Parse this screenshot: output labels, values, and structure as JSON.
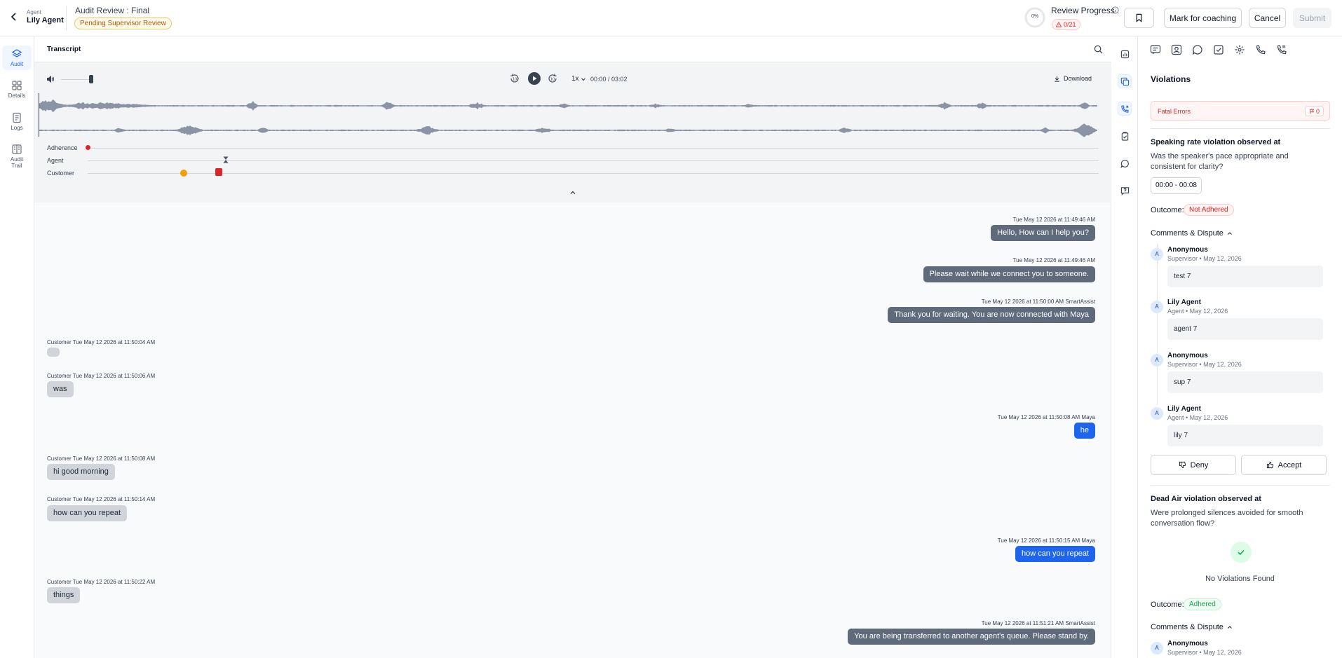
{
  "header": {
    "agent_caption": "Agent",
    "agent_name": "Lily Agent",
    "page_title": "Audit Review : Final",
    "status": "Pending Supervisor Review",
    "progress_percent": "0%",
    "progress_value": 0,
    "review_progress_label": "Review Progress",
    "violation_count": "0/21",
    "mark_coaching": "Mark for coaching",
    "cancel": "Cancel",
    "submit": "Submit"
  },
  "nav": [
    {
      "label": "Audit",
      "icon": "layers-icon",
      "active": true
    },
    {
      "label": "Details",
      "icon": "grid-icon",
      "active": false
    },
    {
      "label": "Logs",
      "icon": "document-icon",
      "active": false
    },
    {
      "label": "Audit Trail",
      "icon": "book-icon",
      "active": false
    }
  ],
  "transcript": {
    "title": "Transcript",
    "speed": "1x",
    "time": "00:00 / 03:02",
    "download": "Download",
    "tracks": [
      "Adherence",
      "Agent",
      "Customer"
    ]
  },
  "messages": [
    {
      "side": "right",
      "meta": "Tue May 12 2026 at 11:49:46 AM",
      "text": "Hello, How can I help you?",
      "style": "dark"
    },
    {
      "side": "right",
      "meta": "Tue May 12 2026 at 11:49:46 AM",
      "text": "Please wait while we connect you to someone.",
      "style": "dark"
    },
    {
      "side": "right",
      "meta": "Tue May 12 2026 at 11:50:00 AM SmartAssist",
      "text": "Thank you for waiting. You are now connected with Maya",
      "style": "dark"
    },
    {
      "side": "left",
      "meta": "Customer  Tue May 12 2026 at 11:50:04 AM",
      "text": "",
      "style": "light"
    },
    {
      "side": "left",
      "meta": "Customer  Tue May 12 2026 at 11:50:06 AM",
      "text": "was",
      "style": "light"
    },
    {
      "side": "right",
      "meta": "Tue May 12 2026 at 11:50:08 AM Maya",
      "text": "he",
      "style": "blue"
    },
    {
      "side": "left",
      "meta": "Customer  Tue May 12 2026 at 11:50:08 AM",
      "text": "hi good morning",
      "style": "light"
    },
    {
      "side": "left",
      "meta": "Customer  Tue May 12 2026 at 11:50:14 AM",
      "text": "how can you repeat",
      "style": "light"
    },
    {
      "side": "right",
      "meta": "Tue May 12 2026 at 11:50:15 AM Maya",
      "text": "how can you repeat",
      "style": "blue"
    },
    {
      "side": "left",
      "meta": "Customer  Tue May 12 2026 at 11:50:22 AM",
      "text": "things",
      "style": "light"
    },
    {
      "side": "right",
      "meta": "Tue May 12 2026 at 11:51:21 AM SmartAssist",
      "text": "You are being transferred to another agent's queue. Please stand by.",
      "style": "dark"
    }
  ],
  "rail": [
    "chart-icon",
    "copy-icon",
    "phone-x-icon",
    "clipboard-check-icon",
    "chat-icon",
    "help-chat-icon"
  ],
  "panel_tabs": [
    "message-icon",
    "contact-card-icon",
    "speech-bubble-icon",
    "checkbox-icon",
    "sparkle-icon",
    "phone-icon",
    "phone-ring-icon"
  ],
  "violations": {
    "title": "Violations",
    "fatal_label": "Fatal Errors",
    "fatal_count": "0",
    "v1": {
      "heading": "Speaking rate violation observed at",
      "question": "Was the speaker's pace appropriate and consistent for clarity?",
      "time_range": "00:00 - 00:08",
      "outcome_label": "Outcome:",
      "outcome": "Not Adhered",
      "comments_toggle": "Comments & Dispute",
      "comments": [
        {
          "initial": "A",
          "name": "Anonymous",
          "meta": "Supervisor • May 12, 2026",
          "text": "test 7"
        },
        {
          "initial": "A",
          "name": "Lily Agent",
          "meta": "Agent • May 12, 2026",
          "text": "agent 7"
        },
        {
          "initial": "A",
          "name": "Anonymous",
          "meta": "Supervisor • May 12, 2026",
          "text": "sup 7"
        },
        {
          "initial": "A",
          "name": "Lily Agent",
          "meta": "Agent • May 12, 2026",
          "text": "lily 7"
        }
      ],
      "deny": "Deny",
      "accept": "Accept"
    },
    "v2": {
      "heading": "Dead Air violation observed at",
      "question": "Were prolonged silences avoided for smooth conversation flow?",
      "no_violations": "No Violations Found",
      "outcome_label": "Outcome:",
      "outcome": "Adhered",
      "comments_toggle": "Comments & Dispute",
      "comment": {
        "initial": "A",
        "name": "Anonymous",
        "meta": "Supervisor • May 12, 2026"
      }
    }
  },
  "colors": {
    "accent": "#2563eb",
    "bubble_dark": "#5f6b7a",
    "bubble_blue": "#1d64ee",
    "bubble_light": "#d1d5db",
    "danger": "#dc2626",
    "success": "#16a34a"
  }
}
